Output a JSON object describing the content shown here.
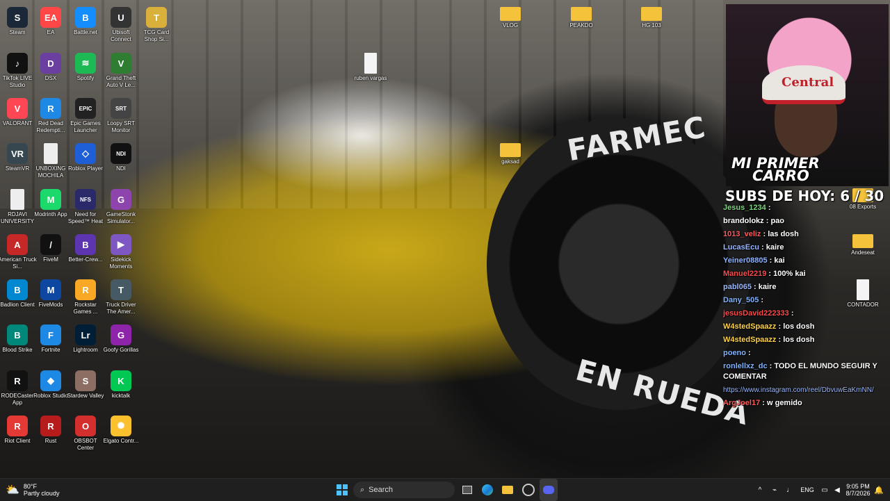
{
  "desktop": {
    "icons": [
      {
        "label": "Steam",
        "color": "#1b2838",
        "glyph": "S"
      },
      {
        "label": "EA",
        "color": "#ff4747",
        "glyph": "EA"
      },
      {
        "label": "Battle.net",
        "color": "#148eff",
        "glyph": "B"
      },
      {
        "label": "Ubisoft Connect",
        "color": "#333",
        "glyph": "U"
      },
      {
        "label": "TCG Card Shop Si...",
        "color": "#d8b03a",
        "glyph": "T"
      },
      {
        "label": "TikTok LIVE Studio",
        "color": "#111",
        "glyph": "♪"
      },
      {
        "label": "DSX",
        "color": "#6b3fa0",
        "glyph": "D"
      },
      {
        "label": "Spotify",
        "color": "#1db954",
        "glyph": "≋"
      },
      {
        "label": "Grand Theft Auto V Le...",
        "color": "#2e7d32",
        "glyph": "V"
      },
      {
        "label": "VALORANT",
        "color": "#ff4655",
        "glyph": "V"
      },
      {
        "label": "Red Dead Redempti...",
        "color": "#1e88e5",
        "glyph": "R"
      },
      {
        "label": "Epic Games Launcher",
        "color": "#222",
        "glyph": "EPIC"
      },
      {
        "label": "Loopy SRT Monitor",
        "color": "#444",
        "glyph": "SRT"
      },
      {
        "label": "SteamVR",
        "color": "#37474f",
        "glyph": "VR"
      },
      {
        "label": "UNBOXING MOCHILA",
        "color": "#eeeeee",
        "glyph": ""
      },
      {
        "label": "Roblox Player",
        "color": "#1e5fd8",
        "glyph": "◇"
      },
      {
        "label": "NDI",
        "color": "#111",
        "glyph": "NDI"
      },
      {
        "label": "RDJAVI UNIVERSITY",
        "color": "#eeeeee",
        "glyph": ""
      },
      {
        "label": "Modrinth App",
        "color": "#1bd96a",
        "glyph": "M"
      },
      {
        "label": "Need for Speed™ Heat",
        "color": "#2a2a6a",
        "glyph": "NFS"
      },
      {
        "label": "GameStonk Simulator...",
        "color": "#8e44ad",
        "glyph": "G"
      },
      {
        "label": "American Truck Si...",
        "color": "#c62828",
        "glyph": "A"
      },
      {
        "label": "FiveM",
        "color": "#111",
        "glyph": "/"
      },
      {
        "label": "Better-Crew...",
        "color": "#5e35b1",
        "glyph": "B"
      },
      {
        "label": "Sidekick Moments",
        "color": "#7e57c2",
        "glyph": "▶"
      },
      {
        "label": "Badlion Client",
        "color": "#0288d1",
        "glyph": "B"
      },
      {
        "label": "FiveMods",
        "color": "#0d47a1",
        "glyph": "M"
      },
      {
        "label": "Rockstar Games ...",
        "color": "#f9a825",
        "glyph": "R"
      },
      {
        "label": "Truck Driver The Amer...",
        "color": "#455a64",
        "glyph": "T"
      },
      {
        "label": "Blood Strike",
        "color": "#00897b",
        "glyph": "B"
      },
      {
        "label": "Fortnite",
        "color": "#1e88e5",
        "glyph": "F"
      },
      {
        "label": "Lightroom",
        "color": "#001e36",
        "glyph": "Lr"
      },
      {
        "label": "Goofy Gorillas",
        "color": "#8e24aa",
        "glyph": "G"
      },
      {
        "label": "RODECaster App",
        "color": "#111",
        "glyph": "R"
      },
      {
        "label": "Roblox Studio",
        "color": "#1e88e5",
        "glyph": "◆"
      },
      {
        "label": "Stardew Valley",
        "color": "#8d6e63",
        "glyph": "S"
      },
      {
        "label": "kicktalk",
        "color": "#00c853",
        "glyph": "K"
      },
      {
        "label": "Riot Client",
        "color": "#e53935",
        "glyph": "R"
      },
      {
        "label": "Rust",
        "color": "#b71c1c",
        "glyph": "R"
      },
      {
        "label": "OBSBOT Center",
        "color": "#d32f2f",
        "glyph": "O"
      },
      {
        "label": "Elgato Contr...",
        "color": "#fbc02d",
        "glyph": "✺"
      }
    ],
    "center_icons": [
      {
        "label": "ruben vargas",
        "type": "file"
      },
      {
        "label": "VLOG",
        "type": "folder"
      },
      {
        "label": "PEAKDO",
        "type": "folder"
      },
      {
        "label": "HG 103",
        "type": "folder"
      },
      {
        "label": "gaksad",
        "type": "folder"
      },
      {
        "label": "08 Exports",
        "type": "folder"
      },
      {
        "label": "Andeseat",
        "type": "folder"
      },
      {
        "label": "CONTADOR",
        "type": "file"
      }
    ]
  },
  "wallpaper": {
    "tire_text_top": "FARMEC",
    "tire_text_bottom": "EN RUEDA"
  },
  "overlay": {
    "cam_title_line1": "MI PRIMER",
    "cam_title_line2": "CARRO",
    "hat_text": "Central",
    "subs": "SUBS DE HOY: 6 / 30"
  },
  "chat": [
    {
      "user": "Jesus_1234",
      "color": "#7fd37f",
      "text": ""
    },
    {
      "user": "brandolokz",
      "color": "#ffffff",
      "text": "pao"
    },
    {
      "user": "1013_veliz",
      "color": "#ff5a5a",
      "text": "las dosh"
    },
    {
      "user": "LucasEcu",
      "color": "#9ab8ff",
      "text": "kaire"
    },
    {
      "user": "Yeiner08805",
      "color": "#8fb4ff",
      "text": "kai"
    },
    {
      "user": "Manuel2219",
      "color": "#ff4a4a",
      "text": "100% kai"
    },
    {
      "user": "pabl065",
      "color": "#9ab8ff",
      "text": "kaire"
    },
    {
      "user": "Dany_505",
      "color": "#7fb2ff",
      "text": ""
    },
    {
      "user": "jesusDavid222333",
      "color": "#ff4a4a",
      "text": ""
    },
    {
      "user": "W4stedSpaazz",
      "color": "#ffd24a",
      "text": "los dosh"
    },
    {
      "user": "W4stedSpaazz",
      "color": "#ffd24a",
      "text": "los dosh"
    },
    {
      "user": "poeno",
      "color": "#7fb2ff",
      "text": ""
    },
    {
      "user": "ronlellxz_dc",
      "color": "#7fb2ff",
      "text": "TODO EL MUNDO SEGUIR Y COMENTAR"
    },
    {
      "user": "",
      "color": "#9ab8ff",
      "text": "https://www.instagram.com/reel/DbvuwEaKmNN/"
    },
    {
      "user": "ArgJoel17",
      "color": "#ff5a5a",
      "text": "w gemido"
    }
  ],
  "taskbar": {
    "weather_temp": "80°F",
    "weather_desc": "Partly cloudy",
    "search_placeholder": "Search",
    "lang": "ENG",
    "time": "9:05 PM",
    "date": "8/7/2026"
  }
}
